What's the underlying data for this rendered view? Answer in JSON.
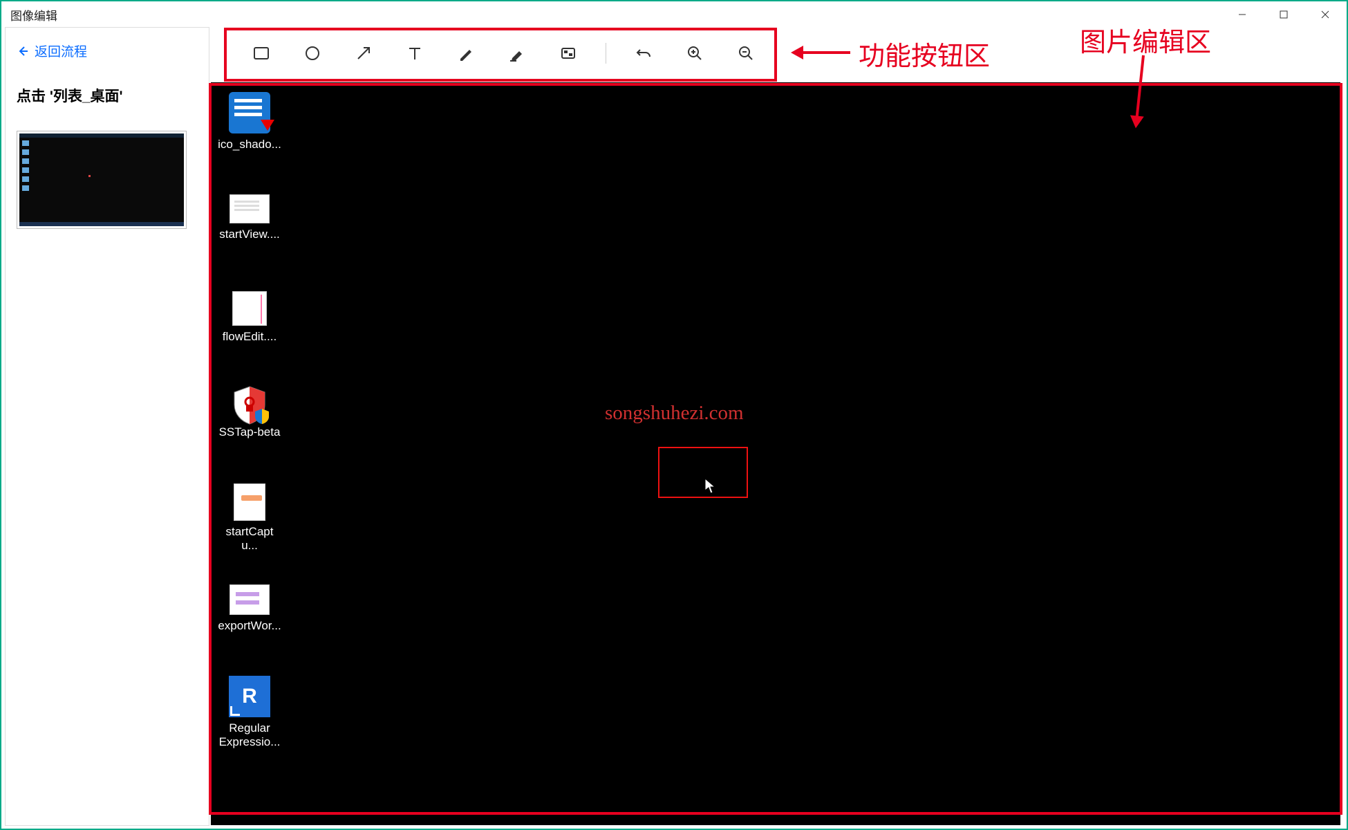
{
  "window": {
    "title": "图像编辑"
  },
  "sidebar": {
    "back_label": "返回流程",
    "step_title": "点击 '列表_桌面'"
  },
  "toolbar": {
    "tools": [
      "rectangle",
      "ellipse",
      "arrow",
      "text",
      "pencil",
      "highlighter",
      "mosaic",
      "undo",
      "zoom-in",
      "zoom-out"
    ]
  },
  "canvas": {
    "watermark": "songshuhezi.com",
    "icons": [
      {
        "name": "ico_shado...",
        "kind": "blue-doc-download"
      },
      {
        "name": "startView....",
        "kind": "white-doc-lines"
      },
      {
        "name": "flowEdit....",
        "kind": "white-doc-pink"
      },
      {
        "name": "SSTap-beta",
        "kind": "shield"
      },
      {
        "name": "startCaptu...",
        "kind": "white-doc-orange"
      },
      {
        "name": "exportWor...",
        "kind": "white-doc-purple"
      },
      {
        "name": "Regular\nExpressio...",
        "kind": "r-blue"
      }
    ]
  },
  "annotations": {
    "label_toolbar": "功能按钮区",
    "label_canvas": "图片编辑区"
  }
}
